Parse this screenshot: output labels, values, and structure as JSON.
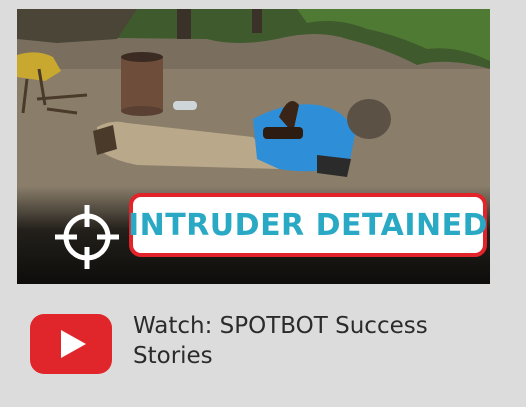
{
  "video": {
    "badge_text": "INTRUDER DETAINED",
    "icon": "crosshair-icon",
    "badge_border_color": "#e2232a",
    "badge_text_color": "#2aa9c4"
  },
  "link": {
    "icon": "youtube-play-icon",
    "icon_color": "#e0262b",
    "label": "Watch: SPOTBOT Success Stories"
  }
}
